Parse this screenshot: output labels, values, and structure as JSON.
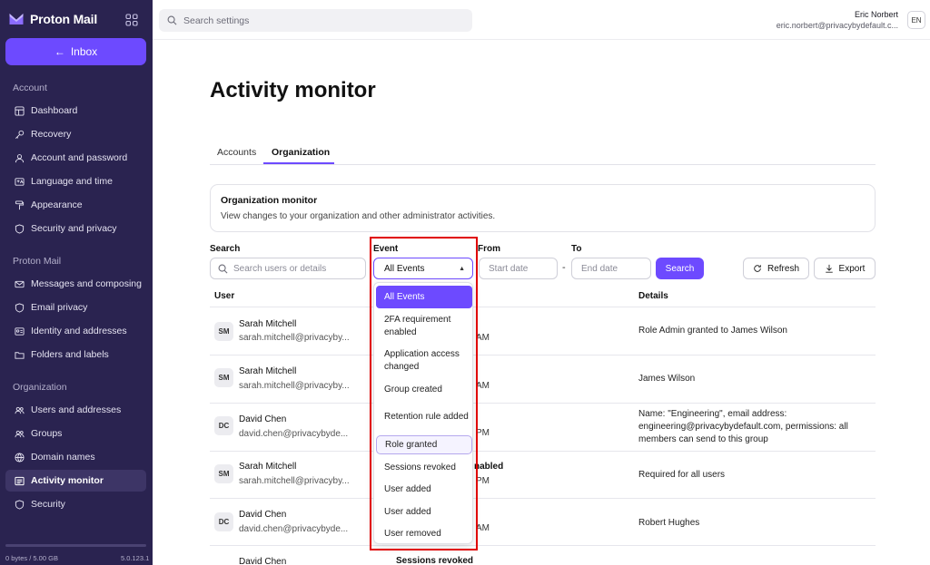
{
  "app": {
    "brand": "Proton Mail",
    "inbox_label": "Inbox"
  },
  "sidebar": {
    "sections": [
      {
        "title": "Account",
        "items": [
          "Dashboard",
          "Recovery",
          "Account and password",
          "Language and time",
          "Appearance",
          "Security and privacy"
        ]
      },
      {
        "title": "Proton Mail",
        "items": [
          "Messages and composing",
          "Email privacy",
          "Identity and addresses",
          "Folders and labels"
        ]
      },
      {
        "title": "Organization",
        "items": [
          "Users and addresses",
          "Groups",
          "Domain names",
          "Activity monitor",
          "Security"
        ]
      }
    ],
    "active_item": "Activity monitor",
    "storage": {
      "text": "0 bytes / 5.00 GB",
      "used_fraction": 0.0
    },
    "version": "5.0.123.1"
  },
  "topbar": {
    "search_placeholder": "Search settings",
    "user_name": "Eric Norbert",
    "user_email": "eric.norbert@privacybydefault.c...",
    "lang": "EN"
  },
  "main": {
    "title": "Activity monitor",
    "tabs": [
      "Accounts",
      "Organization"
    ],
    "active_tab": "Organization",
    "card": {
      "title": "Organization monitor",
      "description": "View changes to your organization and other administrator activities."
    },
    "filters": {
      "search_label": "Search",
      "search_placeholder": "Search users or details",
      "event_label": "Event",
      "event_value": "All Events",
      "from_label": "From",
      "from_placeholder": "Start date",
      "dash": "-",
      "to_label": "To",
      "to_placeholder": "End date",
      "search_button": "Search",
      "refresh_button": "Refresh",
      "export_button": "Export"
    },
    "table": {
      "headers": {
        "user": "User",
        "details": "Details"
      },
      "rows": [
        {
          "initials": "SM",
          "name": "Sarah Mitchell",
          "email": "sarah.mitchell@privacyby...",
          "event": "",
          "time": "AM",
          "details": "Role Admin granted to James Wilson"
        },
        {
          "initials": "SM",
          "name": "Sarah Mitchell",
          "email": "sarah.mitchell@privacyby...",
          "event": "",
          "time": "AM",
          "details": "James Wilson"
        },
        {
          "initials": "DC",
          "name": "David Chen",
          "email": "david.chen@privacybyde...",
          "event": "",
          "time": "PM",
          "details": "Name: \"Engineering\", email address: engineering@privacybydefault.com, permissions: all members can send to this group"
        },
        {
          "initials": "SM",
          "name": "Sarah Mitchell",
          "email": "sarah.mitchell@privacyby...",
          "event": "nabled",
          "time": "PM",
          "details": "Required for all users"
        },
        {
          "initials": "DC",
          "name": "David Chen",
          "email": "david.chen@privacybyde...",
          "event": "",
          "time": "AM",
          "details": "Robert Hughes"
        },
        {
          "initials": "",
          "name": "David Chen",
          "email": "",
          "event": "Sessions revoked",
          "time": "",
          "details": ""
        }
      ]
    },
    "event_dropdown": {
      "options": [
        "All Events",
        "2FA requirement enabled",
        "Application access changed",
        "Group created",
        "Retention rule added",
        "Role granted",
        "Sessions revoked",
        "User added",
        "User added",
        "User removed"
      ],
      "selected": "All Events",
      "hovered": "Role granted"
    },
    "highlight_color": "#e00000"
  },
  "colors": {
    "sidebar_bg": "#2a2350",
    "accent": "#6d4aff"
  }
}
